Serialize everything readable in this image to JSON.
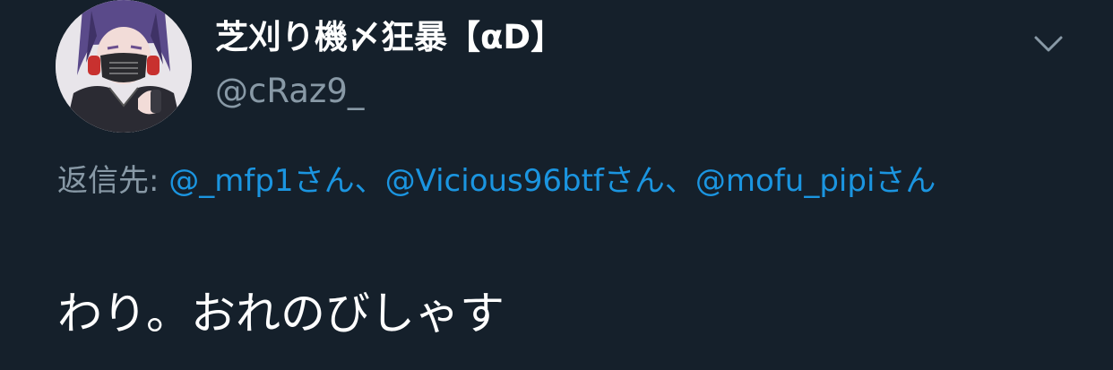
{
  "tweet": {
    "author": {
      "display_name": "芝刈り機〆狂暴【αD】",
      "handle": "@cRaz9_"
    },
    "reply": {
      "prefix": "返信先:",
      "mentions": [
        {
          "handle": "@_mfp1",
          "suffix": "さん"
        },
        {
          "handle": "@Vicious96btf",
          "suffix": "さん"
        },
        {
          "handle": "@mofu_pipi",
          "suffix": "さん"
        }
      ],
      "separator": "、"
    },
    "text": "わり。おれのびしゃす"
  },
  "icons": {
    "menu_caret": "chevron-down-icon",
    "avatar": "user-avatar-image"
  },
  "colors": {
    "background": "#15202b",
    "primary_text": "#ffffff",
    "secondary_text": "#8899a6",
    "link": "#1b95e0"
  }
}
